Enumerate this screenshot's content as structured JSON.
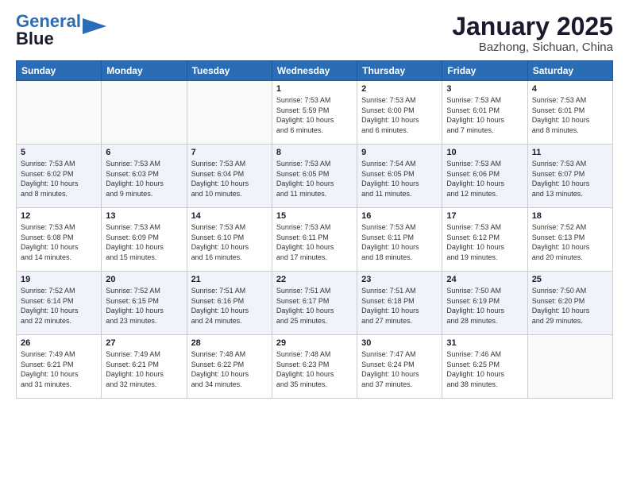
{
  "header": {
    "logo_line1": "General",
    "logo_line2": "Blue",
    "title": "January 2025",
    "subtitle": "Bazhong, Sichuan, China"
  },
  "days_of_week": [
    "Sunday",
    "Monday",
    "Tuesday",
    "Wednesday",
    "Thursday",
    "Friday",
    "Saturday"
  ],
  "weeks": [
    [
      {
        "day": "",
        "info": ""
      },
      {
        "day": "",
        "info": ""
      },
      {
        "day": "",
        "info": ""
      },
      {
        "day": "1",
        "info": "Sunrise: 7:53 AM\nSunset: 5:59 PM\nDaylight: 10 hours\nand 6 minutes."
      },
      {
        "day": "2",
        "info": "Sunrise: 7:53 AM\nSunset: 6:00 PM\nDaylight: 10 hours\nand 6 minutes."
      },
      {
        "day": "3",
        "info": "Sunrise: 7:53 AM\nSunset: 6:01 PM\nDaylight: 10 hours\nand 7 minutes."
      },
      {
        "day": "4",
        "info": "Sunrise: 7:53 AM\nSunset: 6:01 PM\nDaylight: 10 hours\nand 8 minutes."
      }
    ],
    [
      {
        "day": "5",
        "info": "Sunrise: 7:53 AM\nSunset: 6:02 PM\nDaylight: 10 hours\nand 8 minutes."
      },
      {
        "day": "6",
        "info": "Sunrise: 7:53 AM\nSunset: 6:03 PM\nDaylight: 10 hours\nand 9 minutes."
      },
      {
        "day": "7",
        "info": "Sunrise: 7:53 AM\nSunset: 6:04 PM\nDaylight: 10 hours\nand 10 minutes."
      },
      {
        "day": "8",
        "info": "Sunrise: 7:53 AM\nSunset: 6:05 PM\nDaylight: 10 hours\nand 11 minutes."
      },
      {
        "day": "9",
        "info": "Sunrise: 7:54 AM\nSunset: 6:05 PM\nDaylight: 10 hours\nand 11 minutes."
      },
      {
        "day": "10",
        "info": "Sunrise: 7:53 AM\nSunset: 6:06 PM\nDaylight: 10 hours\nand 12 minutes."
      },
      {
        "day": "11",
        "info": "Sunrise: 7:53 AM\nSunset: 6:07 PM\nDaylight: 10 hours\nand 13 minutes."
      }
    ],
    [
      {
        "day": "12",
        "info": "Sunrise: 7:53 AM\nSunset: 6:08 PM\nDaylight: 10 hours\nand 14 minutes."
      },
      {
        "day": "13",
        "info": "Sunrise: 7:53 AM\nSunset: 6:09 PM\nDaylight: 10 hours\nand 15 minutes."
      },
      {
        "day": "14",
        "info": "Sunrise: 7:53 AM\nSunset: 6:10 PM\nDaylight: 10 hours\nand 16 minutes."
      },
      {
        "day": "15",
        "info": "Sunrise: 7:53 AM\nSunset: 6:11 PM\nDaylight: 10 hours\nand 17 minutes."
      },
      {
        "day": "16",
        "info": "Sunrise: 7:53 AM\nSunset: 6:11 PM\nDaylight: 10 hours\nand 18 minutes."
      },
      {
        "day": "17",
        "info": "Sunrise: 7:53 AM\nSunset: 6:12 PM\nDaylight: 10 hours\nand 19 minutes."
      },
      {
        "day": "18",
        "info": "Sunrise: 7:52 AM\nSunset: 6:13 PM\nDaylight: 10 hours\nand 20 minutes."
      }
    ],
    [
      {
        "day": "19",
        "info": "Sunrise: 7:52 AM\nSunset: 6:14 PM\nDaylight: 10 hours\nand 22 minutes."
      },
      {
        "day": "20",
        "info": "Sunrise: 7:52 AM\nSunset: 6:15 PM\nDaylight: 10 hours\nand 23 minutes."
      },
      {
        "day": "21",
        "info": "Sunrise: 7:51 AM\nSunset: 6:16 PM\nDaylight: 10 hours\nand 24 minutes."
      },
      {
        "day": "22",
        "info": "Sunrise: 7:51 AM\nSunset: 6:17 PM\nDaylight: 10 hours\nand 25 minutes."
      },
      {
        "day": "23",
        "info": "Sunrise: 7:51 AM\nSunset: 6:18 PM\nDaylight: 10 hours\nand 27 minutes."
      },
      {
        "day": "24",
        "info": "Sunrise: 7:50 AM\nSunset: 6:19 PM\nDaylight: 10 hours\nand 28 minutes."
      },
      {
        "day": "25",
        "info": "Sunrise: 7:50 AM\nSunset: 6:20 PM\nDaylight: 10 hours\nand 29 minutes."
      }
    ],
    [
      {
        "day": "26",
        "info": "Sunrise: 7:49 AM\nSunset: 6:21 PM\nDaylight: 10 hours\nand 31 minutes."
      },
      {
        "day": "27",
        "info": "Sunrise: 7:49 AM\nSunset: 6:21 PM\nDaylight: 10 hours\nand 32 minutes."
      },
      {
        "day": "28",
        "info": "Sunrise: 7:48 AM\nSunset: 6:22 PM\nDaylight: 10 hours\nand 34 minutes."
      },
      {
        "day": "29",
        "info": "Sunrise: 7:48 AM\nSunset: 6:23 PM\nDaylight: 10 hours\nand 35 minutes."
      },
      {
        "day": "30",
        "info": "Sunrise: 7:47 AM\nSunset: 6:24 PM\nDaylight: 10 hours\nand 37 minutes."
      },
      {
        "day": "31",
        "info": "Sunrise: 7:46 AM\nSunset: 6:25 PM\nDaylight: 10 hours\nand 38 minutes."
      },
      {
        "day": "",
        "info": ""
      }
    ]
  ]
}
